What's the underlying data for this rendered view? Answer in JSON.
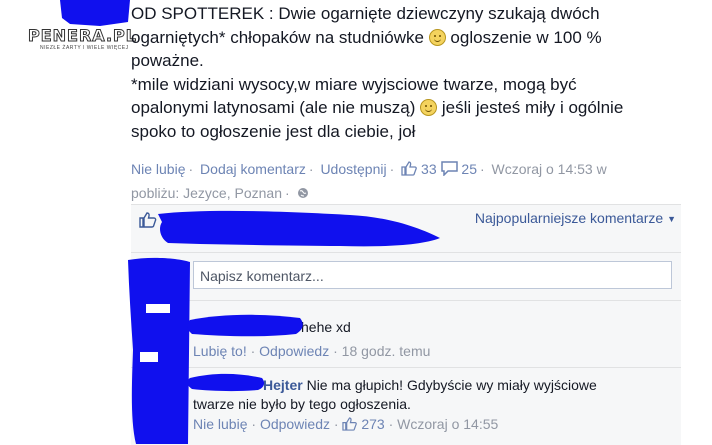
{
  "watermark": {
    "logo_text": "PENERA.PL",
    "tagline": "NIEZŁE ŻARTY I WIELE WIĘCEJ"
  },
  "post": {
    "line1a": "OD SPOTTEREK : Dwie ogarnięte dziewczyny szukają dwóch",
    "line2a": "ogarniętych* chłopaków na studniówke",
    "line2b": " ogloszenie w 100 %",
    "line3": "poważne.",
    "line4": "*mile widziani wysocy,w miare wyjsciowe twarze, mogą być",
    "line5a": "opalonymi latynosami (ale nie muszą)",
    "line5b": " jeśli jesteś miły i ogólnie",
    "line6": "spoko to ogłoszenie jest dla ciebie, joł"
  },
  "actions": {
    "unlike": "Nie lubię",
    "comment": "Dodaj komentarz",
    "share": "Udostępnij",
    "likes_count": "33",
    "comments_count": "25",
    "time": "Wczoraj o 14:53 w",
    "location": "pobliżu: Jezyce, Poznan"
  },
  "comments_panel": {
    "sort_label": "Najpopularniejsze komentarze",
    "input_placeholder": "Napisz komentarz..."
  },
  "comments": [
    {
      "text": "hehe xd",
      "like": "Lubię to!",
      "reply": "Odpowiedz",
      "time": "18 godz. temu"
    },
    {
      "author": "Hejter",
      "text1": "Nie ma głupich! Gdybyście wy miały wyjściowe",
      "text2": "twarze nie było by tego ogłoszenia.",
      "unlike": "Nie lubię",
      "reply": "Odpowiedz",
      "likes": "273",
      "time": "Wczoraj o 14:55"
    }
  ],
  "colors": {
    "link": "#6d84b4",
    "name": "#3b5998",
    "scribble": "#1010ee",
    "panel": "#f6f7f8"
  }
}
